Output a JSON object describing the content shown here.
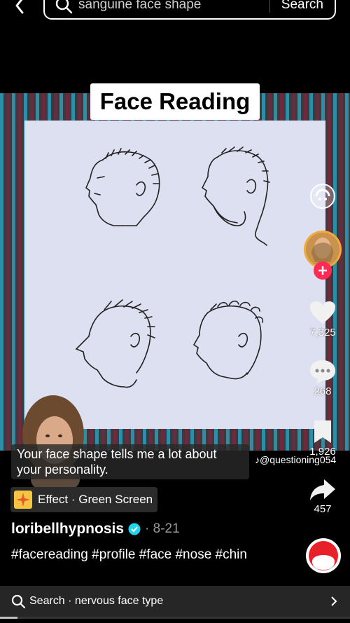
{
  "header": {
    "search_query": "sanguine face shape",
    "search_button": "Search"
  },
  "video": {
    "title_card": "Face Reading",
    "subtitle": "Your face shape tells me a lot about your personality.",
    "watermark": "@questioning054",
    "stripe_colors": [
      "#2e8ea8",
      "#6b2b3c",
      "#3a3a40"
    ],
    "sketch_background": "#dde0f1"
  },
  "rail": {
    "likes": "7,325",
    "comments": "268",
    "saves": "1,926",
    "shares": "457",
    "follow_accent": "#fe2c55"
  },
  "effect": {
    "label": "Effect · Green Screen"
  },
  "post": {
    "author": "loribellhypnosis",
    "date": "· 8-21",
    "hashtags": "#facereading #profile #face #nose #chin"
  },
  "related_search": {
    "label": "Search · nervous face type"
  },
  "playback": {
    "progress_fraction": 0.05
  }
}
